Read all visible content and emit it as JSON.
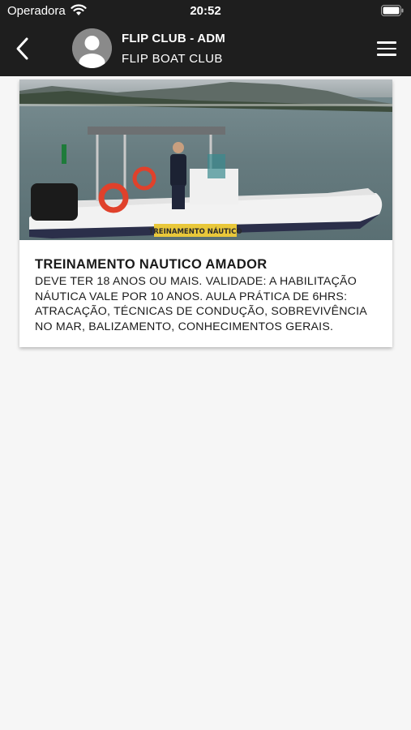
{
  "status_bar": {
    "carrier": "Operadora",
    "time": "20:52"
  },
  "header": {
    "title": "FLIP CLUB - ADM",
    "subtitle": "FLIP BOAT CLUB"
  },
  "card": {
    "image_label": "TREINAMENTO NÁUTICO",
    "title": "TREINAMENTO NAUTICO AMADOR",
    "description": "DEVE TER 18 ANOS OU MAIS.  VALIDADE: A HABILITAÇÃO NÁUTICA VALE POR 10 ANOS.  AULA PRÁTICA DE 6HRS: ATRACAÇÃO, TÉCNICAS DE CONDUÇÃO, SOBREVIVÊNCIA NO MAR, BALIZAMENTO, CONHECIMENTOS GERAIS."
  },
  "colors": {
    "header_bg": "#1e1e1e",
    "page_bg": "#f6f6f6",
    "card_bg": "#ffffff",
    "text": "#1a1a1a"
  },
  "icons": [
    "wifi-icon",
    "battery-icon",
    "back-icon",
    "avatar-icon",
    "menu-icon"
  ]
}
